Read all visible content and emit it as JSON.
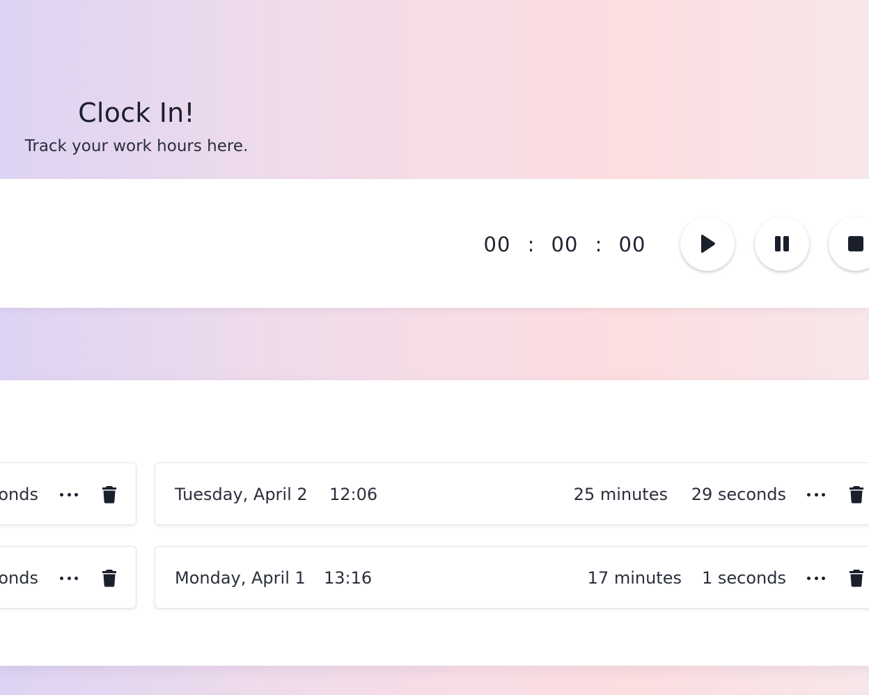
{
  "header": {
    "title": "Clock In!",
    "subtitle": "Track your work hours here."
  },
  "timer": {
    "hours": "00",
    "minutes": "00",
    "seconds": "00",
    "separator": ":"
  },
  "controls": {
    "play_icon": "play-icon",
    "pause_icon": "pause-icon",
    "stop_icon": "stop-icon"
  },
  "entries": [
    {
      "left_partial": "onds",
      "date": "Tuesday, April 2",
      "time": "12:06",
      "minutes": "25 minutes",
      "seconds": "29 seconds"
    },
    {
      "left_partial": "onds",
      "date": "Monday, April 1",
      "time": "13:16",
      "minutes": "17 minutes",
      "seconds": "1 seconds"
    }
  ],
  "colors": {
    "text": "#1b1f2c",
    "gradient_start": "#ddd3f3",
    "gradient_end": "#fcdde0"
  }
}
